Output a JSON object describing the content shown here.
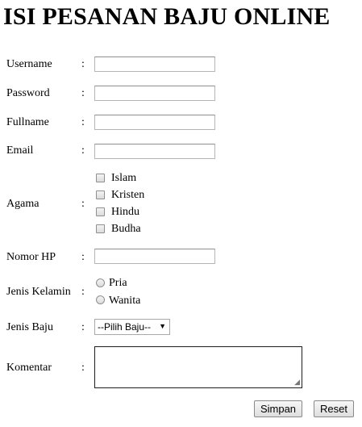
{
  "page_title": "ISI PESANAN BAJU ONLINE",
  "colon": ":",
  "fields": {
    "username": {
      "label": "Username",
      "value": ""
    },
    "password": {
      "label": "Password",
      "value": ""
    },
    "fullname": {
      "label": "Fullname",
      "value": ""
    },
    "email": {
      "label": "Email",
      "value": ""
    },
    "nomor_hp": {
      "label": "Nomor HP",
      "value": ""
    }
  },
  "agama": {
    "label": "Agama",
    "options": [
      {
        "label": "Islam",
        "checked": false
      },
      {
        "label": "Kristen",
        "checked": false
      },
      {
        "label": "Hindu",
        "checked": false
      },
      {
        "label": "Budha",
        "checked": false
      }
    ]
  },
  "jenis_kelamin": {
    "label": "Jenis Kelamin",
    "options": [
      {
        "label": "Pria",
        "selected": false
      },
      {
        "label": "Wanita",
        "selected": false
      }
    ]
  },
  "jenis_baju": {
    "label": "Jenis Baju",
    "selected": "--Pilih Baju--",
    "arrow_icon": "triangle-down-icon"
  },
  "komentar": {
    "label": "Komentar",
    "value": ""
  },
  "buttons": {
    "simpan": "Simpan",
    "reset": "Reset"
  }
}
